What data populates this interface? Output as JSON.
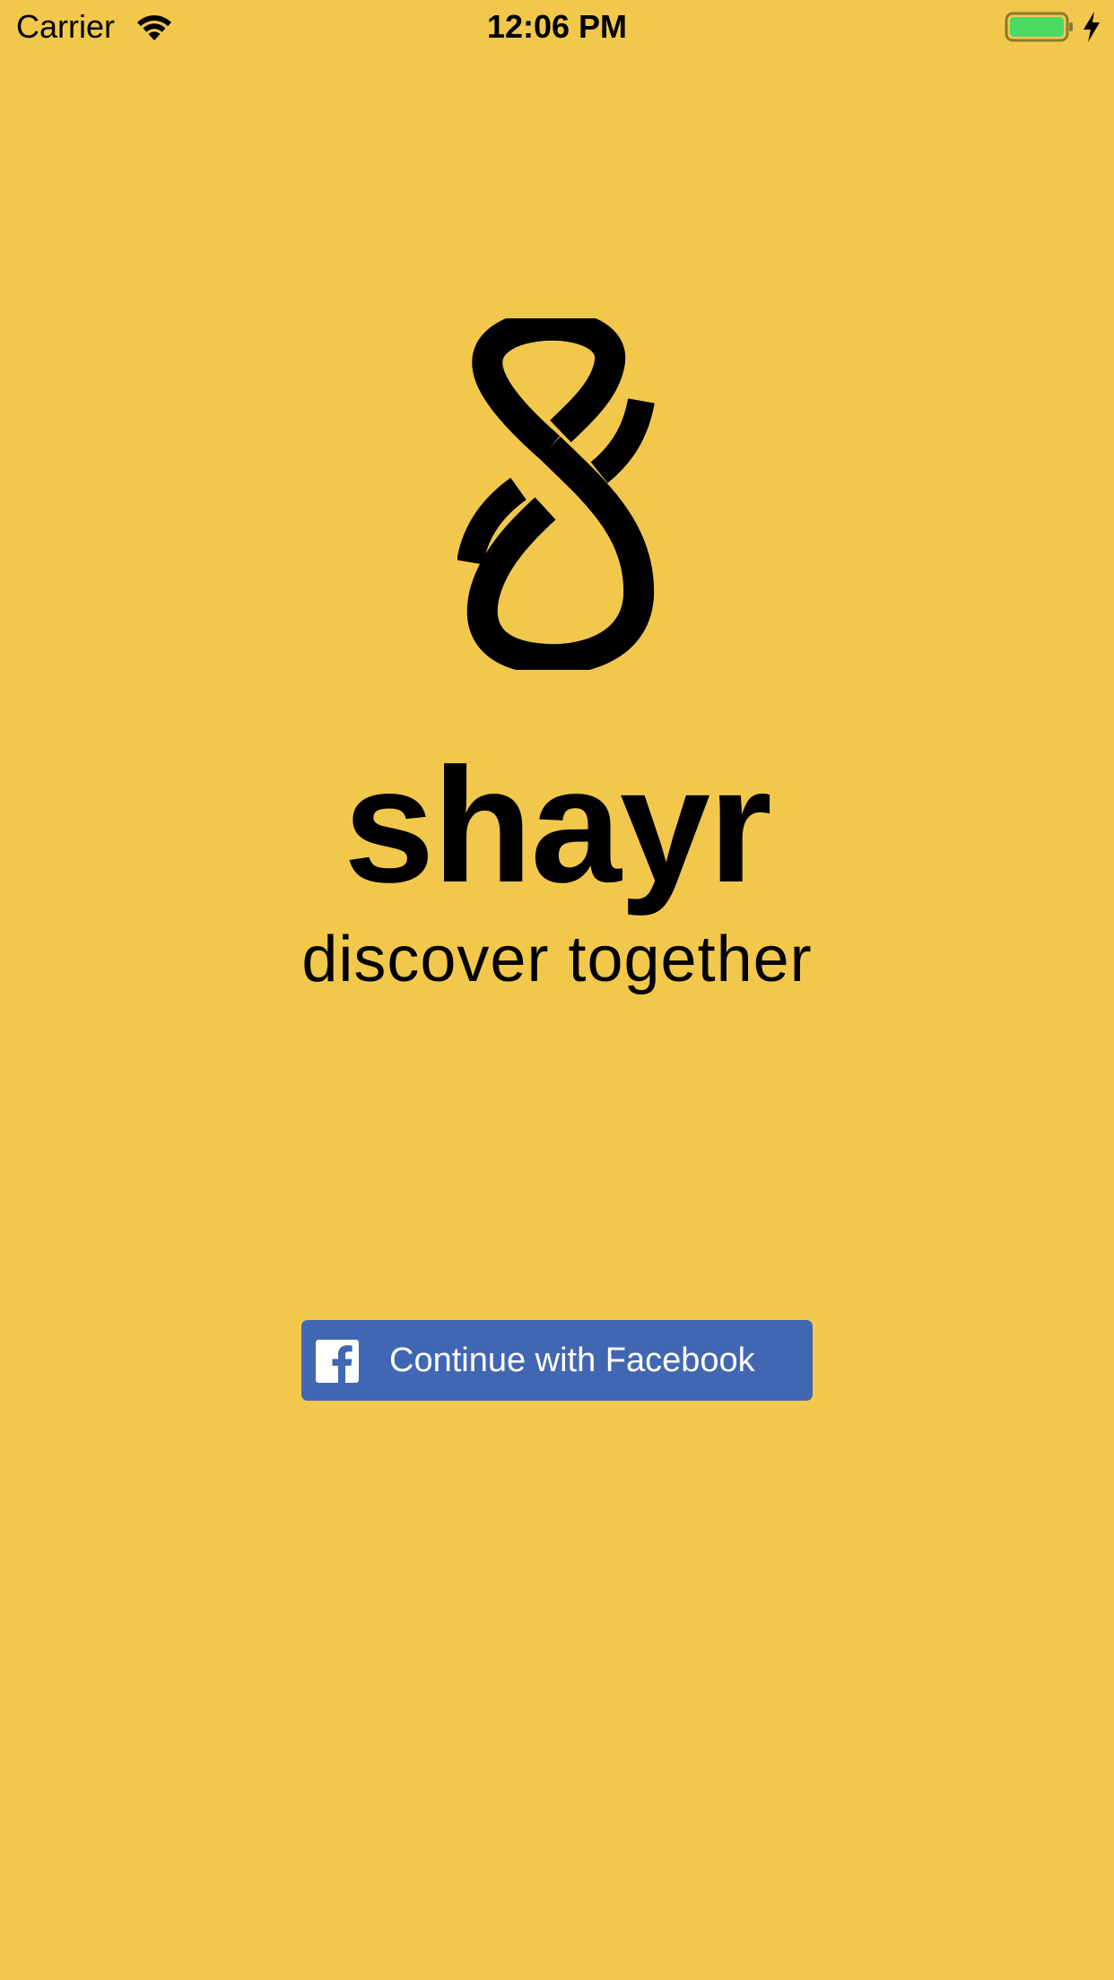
{
  "colors": {
    "background": "#F2C84C",
    "text": "#000000",
    "facebook_blue": "#4267B2",
    "battery_fill": "#4CD964",
    "battery_outline": "#8A7A2E"
  },
  "status_bar": {
    "carrier": "Carrier",
    "time": "12:06 PM",
    "icons": [
      "wifi-icon",
      "battery-icon",
      "charging-bolt-icon"
    ]
  },
  "brand": {
    "logo_icon": "shayr-logo-icon",
    "name": "shayr",
    "tagline": "discover together"
  },
  "login": {
    "facebook_button_label": "Continue with Facebook",
    "facebook_icon": "facebook-icon"
  }
}
